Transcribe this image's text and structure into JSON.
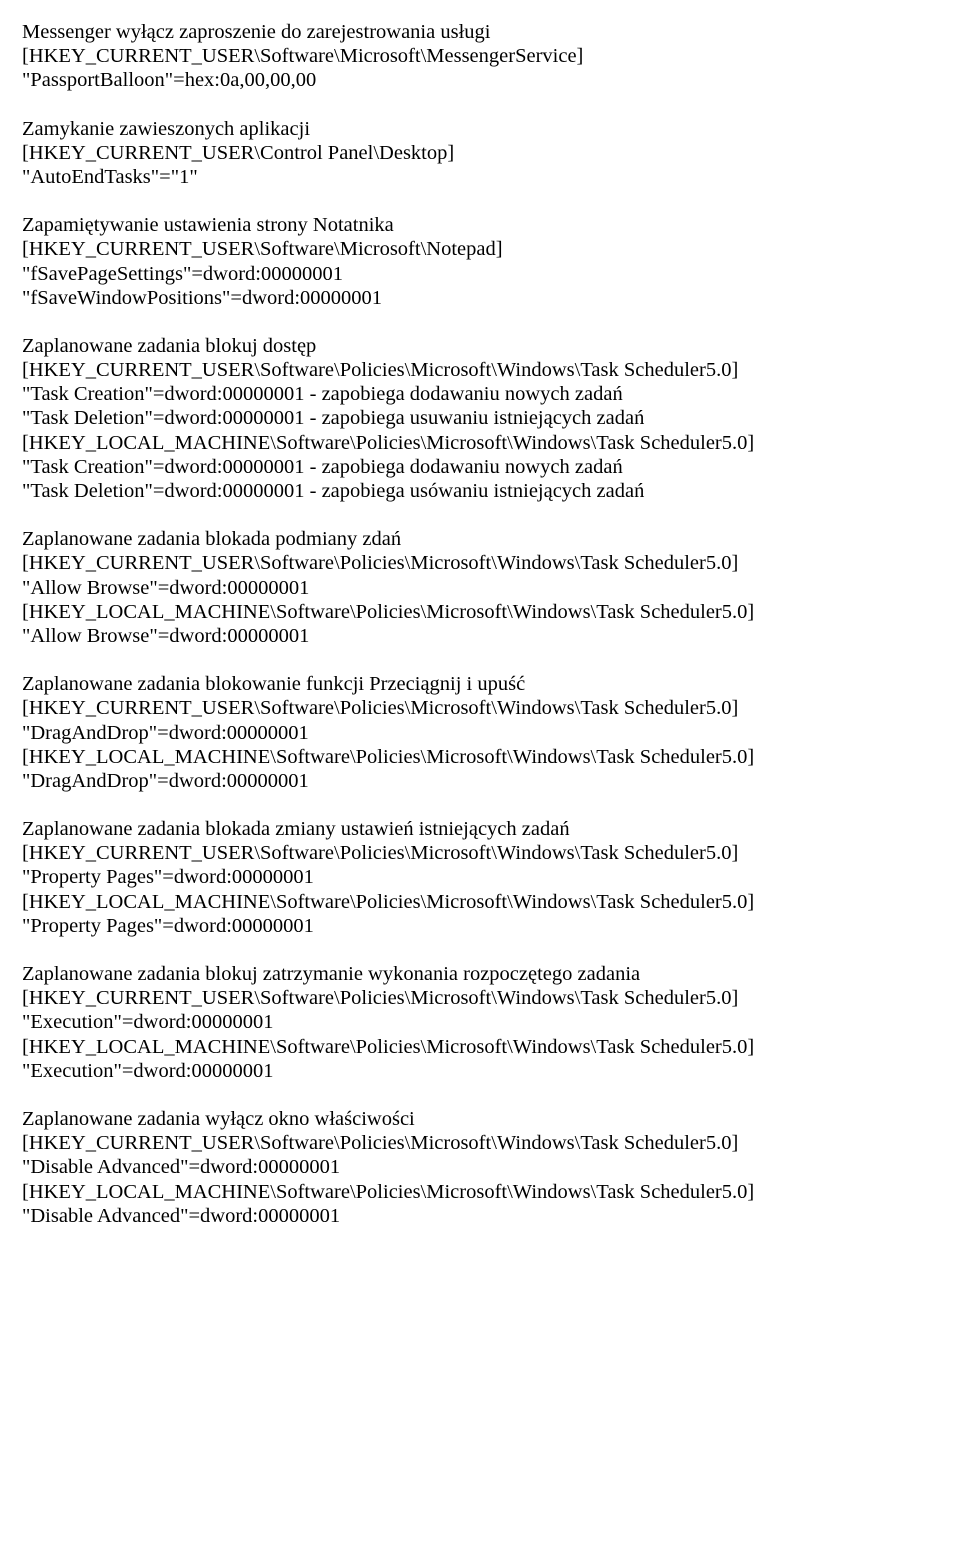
{
  "blocks": [
    {
      "lines": [
        "Messenger wyłącz zaproszenie do zarejestrowania usługi",
        "[HKEY_CURRENT_USER\\Software\\Microsoft\\MessengerService]",
        "\"PassportBalloon\"=hex:0a,00,00,00"
      ]
    },
    {
      "lines": [
        "Zamykanie zawieszonych aplikacji",
        "[HKEY_CURRENT_USER\\Control Panel\\Desktop]",
        "\"AutoEndTasks\"=\"1\""
      ]
    },
    {
      "lines": [
        "Zapamiętywanie ustawienia strony Notatnika",
        "[HKEY_CURRENT_USER\\Software\\Microsoft\\Notepad]",
        "\"fSavePageSettings\"=dword:00000001",
        "\"fSaveWindowPositions\"=dword:00000001"
      ]
    },
    {
      "lines": [
        "Zaplanowane zadania blokuj dostęp",
        "[HKEY_CURRENT_USER\\Software\\Policies\\Microsoft\\Windows\\Task Scheduler5.0]",
        "\"Task Creation\"=dword:00000001 - zapobiega dodawaniu nowych zadań",
        "\"Task Deletion\"=dword:00000001 - zapobiega usuwaniu istniejących zadań",
        "[HKEY_LOCAL_MACHINE\\Software\\Policies\\Microsoft\\Windows\\Task Scheduler5.0]",
        "\"Task Creation\"=dword:00000001 - zapobiega dodawaniu nowych zadań",
        "\"Task Deletion\"=dword:00000001 - zapobiega usówaniu istniejących zadań"
      ]
    },
    {
      "lines": [
        "Zaplanowane zadania blokada podmiany zdań",
        "[HKEY_CURRENT_USER\\Software\\Policies\\Microsoft\\Windows\\Task Scheduler5.0]",
        "\"Allow Browse\"=dword:00000001",
        "[HKEY_LOCAL_MACHINE\\Software\\Policies\\Microsoft\\Windows\\Task Scheduler5.0]",
        "\"Allow Browse\"=dword:00000001"
      ]
    },
    {
      "lines": [
        "Zaplanowane zadania blokowanie funkcji Przeciągnij i upuść",
        "[HKEY_CURRENT_USER\\Software\\Policies\\Microsoft\\Windows\\Task Scheduler5.0]",
        "\"DragAndDrop\"=dword:00000001",
        "[HKEY_LOCAL_MACHINE\\Software\\Policies\\Microsoft\\Windows\\Task Scheduler5.0]",
        "\"DragAndDrop\"=dword:00000001"
      ]
    },
    {
      "lines": [
        "Zaplanowane zadania blokada zmiany ustawień istniejących zadań",
        "[HKEY_CURRENT_USER\\Software\\Policies\\Microsoft\\Windows\\Task Scheduler5.0]",
        "\"Property Pages\"=dword:00000001",
        "[HKEY_LOCAL_MACHINE\\Software\\Policies\\Microsoft\\Windows\\Task Scheduler5.0]",
        "\"Property Pages\"=dword:00000001"
      ]
    },
    {
      "lines": [
        "Zaplanowane zadania blokuj zatrzymanie wykonania rozpoczętego zadania",
        "[HKEY_CURRENT_USER\\Software\\Policies\\Microsoft\\Windows\\Task Scheduler5.0]",
        "\"Execution\"=dword:00000001",
        "[HKEY_LOCAL_MACHINE\\Software\\Policies\\Microsoft\\Windows\\Task Scheduler5.0]",
        "\"Execution\"=dword:00000001"
      ]
    },
    {
      "lines": [
        "Zaplanowane zadania wyłącz okno właściwości",
        "[HKEY_CURRENT_USER\\Software\\Policies\\Microsoft\\Windows\\Task Scheduler5.0]",
        "\"Disable Advanced\"=dword:00000001",
        "[HKEY_LOCAL_MACHINE\\Software\\Policies\\Microsoft\\Windows\\Task Scheduler5.0]",
        "\"Disable Advanced\"=dword:00000001"
      ]
    }
  ]
}
